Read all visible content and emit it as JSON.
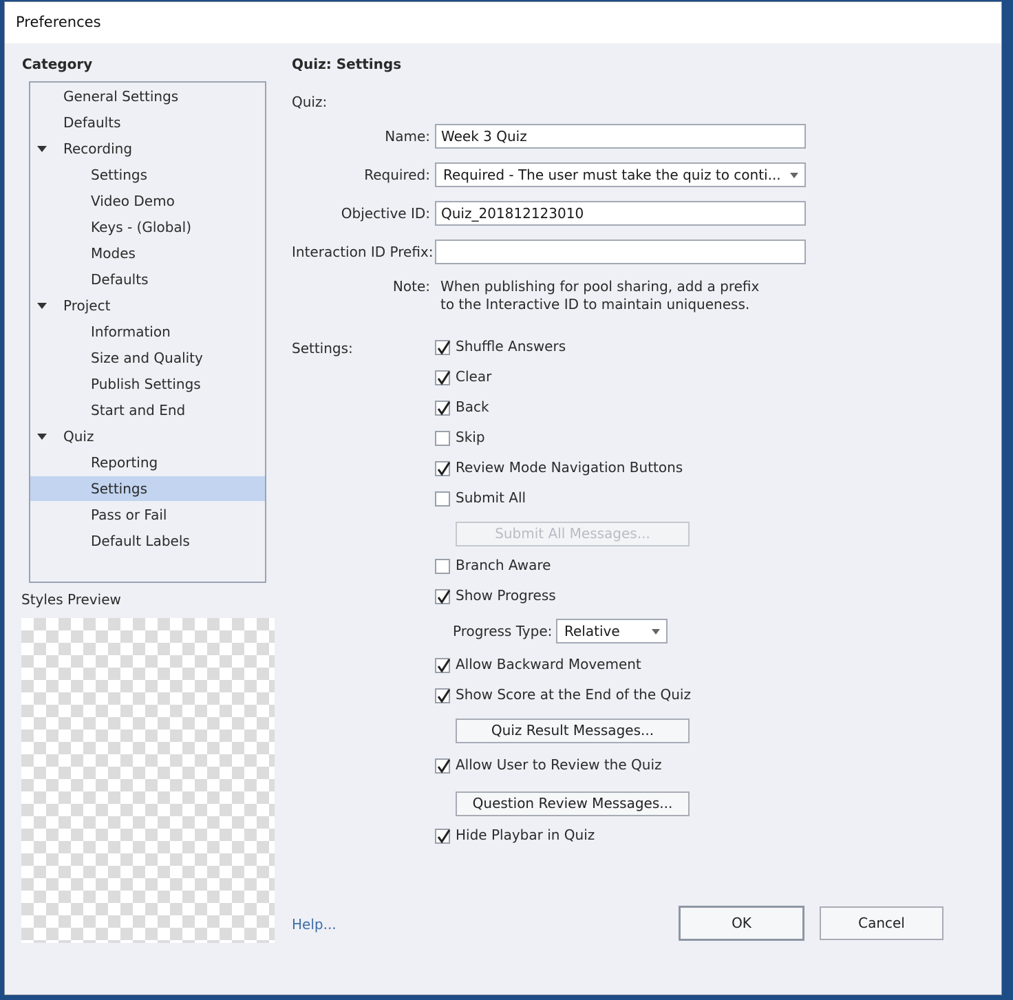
{
  "window": {
    "title": "Preferences"
  },
  "category": {
    "heading": "Category",
    "items": [
      {
        "label": "General Settings",
        "level": 1
      },
      {
        "label": "Defaults",
        "level": 1
      },
      {
        "label": "Recording",
        "level": 1,
        "expanded": true
      },
      {
        "label": "Settings",
        "level": 2
      },
      {
        "label": "Video Demo",
        "level": 2
      },
      {
        "label": "Keys - (Global)",
        "level": 2
      },
      {
        "label": "Modes",
        "level": 2
      },
      {
        "label": "Defaults",
        "level": 2
      },
      {
        "label": "Project",
        "level": 1,
        "expanded": true
      },
      {
        "label": "Information",
        "level": 2
      },
      {
        "label": "Size and Quality",
        "level": 2
      },
      {
        "label": "Publish Settings",
        "level": 2
      },
      {
        "label": "Start and End",
        "level": 2
      },
      {
        "label": "Quiz",
        "level": 1,
        "expanded": true
      },
      {
        "label": "Reporting",
        "level": 2
      },
      {
        "label": "Settings",
        "level": 2,
        "selected": true
      },
      {
        "label": "Pass or Fail",
        "level": 2
      },
      {
        "label": "Default Labels",
        "level": 2
      }
    ]
  },
  "styles_preview": {
    "label": "Styles Preview"
  },
  "panel": {
    "heading": "Quiz: Settings",
    "quiz_section": "Quiz:",
    "name": {
      "label": "Name:",
      "value": "Week 3 Quiz"
    },
    "required": {
      "label": "Required:",
      "value": "Required - The user must take the quiz to conti..."
    },
    "objective_id": {
      "label": "Objective ID:",
      "value": "Quiz_201812123010"
    },
    "interaction_prefix": {
      "label": "Interaction ID Prefix:",
      "value": ""
    },
    "note": {
      "label": "Note:",
      "line1": "When publishing for pool sharing, add a prefix",
      "line2": "to the Interactive ID to maintain uniqueness."
    },
    "settings_section": "Settings:",
    "shuffle_answers": {
      "label": "Shuffle Answers",
      "checked": true
    },
    "clear": {
      "label": "Clear",
      "checked": true
    },
    "back": {
      "label": "Back",
      "checked": true
    },
    "skip": {
      "label": "Skip",
      "checked": false
    },
    "review_nav": {
      "label": "Review Mode Navigation Buttons",
      "checked": true
    },
    "submit_all": {
      "label": "Submit All",
      "checked": false
    },
    "submit_all_messages": "Submit All Messages...",
    "branch_aware": {
      "label": "Branch Aware",
      "checked": false
    },
    "show_progress": {
      "label": "Show Progress",
      "checked": true
    },
    "progress_type": {
      "label": "Progress Type:",
      "value": "Relative"
    },
    "allow_backward": {
      "label": "Allow Backward Movement",
      "checked": true
    },
    "show_score": {
      "label": "Show Score at the End of the Quiz",
      "checked": true
    },
    "quiz_result_messages": "Quiz Result Messages...",
    "allow_review": {
      "label": "Allow User to Review the Quiz",
      "checked": true
    },
    "question_review_messages": "Question Review Messages...",
    "hide_playbar": {
      "label": "Hide Playbar in Quiz",
      "checked": true
    }
  },
  "footer": {
    "help": "Help...",
    "ok": "OK",
    "cancel": "Cancel"
  },
  "colors": {
    "selection": "#c2d4ef",
    "link": "#3f6ea8",
    "dialog_bg": "#eef0f5"
  }
}
